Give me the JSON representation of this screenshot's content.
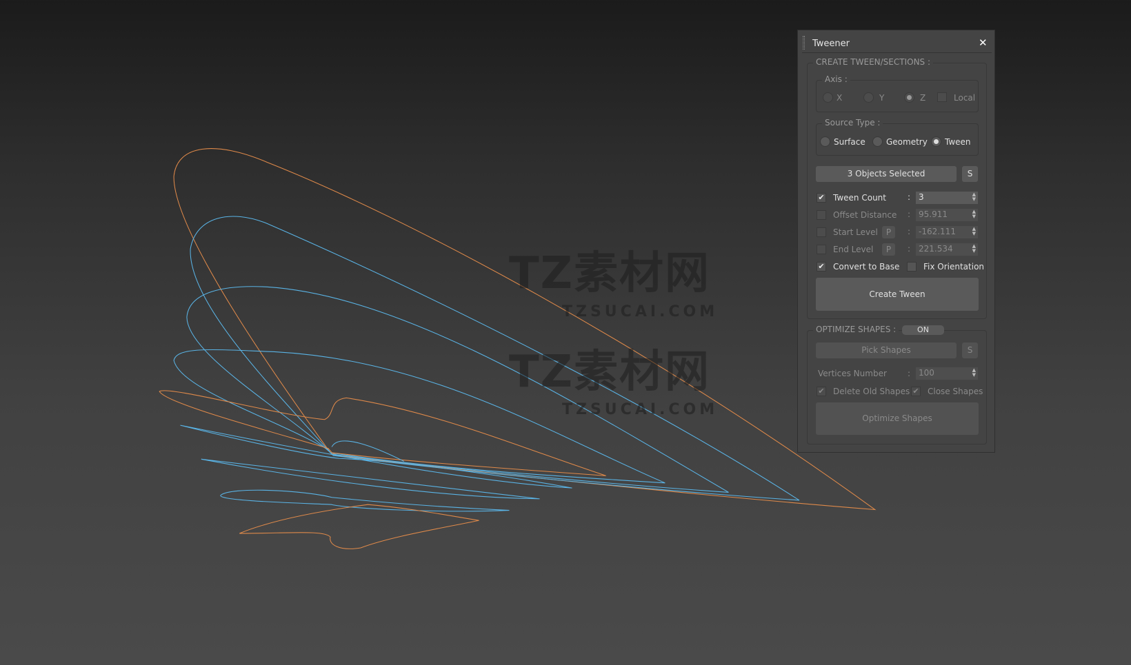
{
  "watermark": {
    "logo_text": "TZ素材网",
    "logo_sub": "TZSUCAI.COM"
  },
  "viewport": {
    "colors": {
      "orange": "#e08a4a",
      "blue": "#5ab4e6"
    }
  },
  "panel": {
    "title": "Tweener",
    "close": "✕",
    "create_group": {
      "label": "CREATE TWEEN/SECTIONS :",
      "axis": {
        "label": "Axis :",
        "options": [
          {
            "label": "X",
            "checked": false
          },
          {
            "label": "Y",
            "checked": false
          },
          {
            "label": "Z",
            "checked": true
          }
        ],
        "local_label": "Local",
        "local_checked": false
      },
      "source_type": {
        "label": "Source Type :",
        "options": [
          {
            "label": "Surface",
            "checked": false
          },
          {
            "label": "Geometry",
            "checked": false
          },
          {
            "label": "Tween",
            "checked": true
          }
        ]
      },
      "objects_button": "3 Objects Selected",
      "s_button": "S",
      "rows": [
        {
          "label": "Tween Count",
          "checked": true,
          "value": "3"
        },
        {
          "label": "Offset Distance",
          "checked": false,
          "value": "95.911"
        },
        {
          "label": "Start Level",
          "checked": false,
          "value": "-162.111",
          "p": "P"
        },
        {
          "label": "End Level",
          "checked": false,
          "value": "221.534",
          "p": "P"
        }
      ],
      "colon": ":",
      "convert_to_base": {
        "label": "Convert to Base",
        "checked": true
      },
      "fix_orientation": {
        "label": "Fix Orientation",
        "checked": false
      },
      "create_button": "Create Tween"
    },
    "optimize_group": {
      "label": "OPTIMIZE SHAPES :",
      "toggle": "ON",
      "pick_button": "Pick Shapes",
      "s_button": "S",
      "vertices_label": "Vertices Number",
      "vertices_value": "100",
      "delete_old": {
        "label": "Delete Old Shapes",
        "checked": true
      },
      "close_shapes": {
        "label": "Close Shapes",
        "checked": true
      },
      "optimize_button": "Optimize Shapes"
    }
  }
}
